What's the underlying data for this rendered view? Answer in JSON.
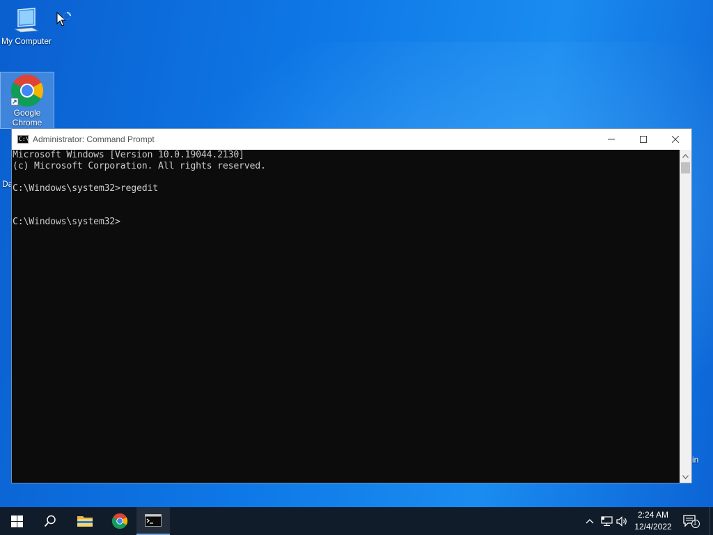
{
  "desktop": {
    "icons": [
      {
        "label": "My Computer"
      },
      {
        "label": "Google Chrome"
      }
    ],
    "partial_left": "Da",
    "partial_right": "in"
  },
  "window": {
    "title": "Administrator: Command Prompt",
    "console_lines": [
      "Microsoft Windows [Version 10.0.19044.2130]",
      "(c) Microsoft Corporation. All rights reserved.",
      "",
      "C:\\Windows\\system32>regedit",
      "",
      "",
      "C:\\Windows\\system32>"
    ]
  },
  "taskbar": {
    "clock_time": "2:24 AM",
    "clock_date": "12/4/2022",
    "notification_count": "1"
  },
  "colors": {
    "desktop_blue": "#0e78e6",
    "taskbar": "#111c2b",
    "console_bg": "#0c0c0c",
    "console_text": "#cccccc"
  }
}
